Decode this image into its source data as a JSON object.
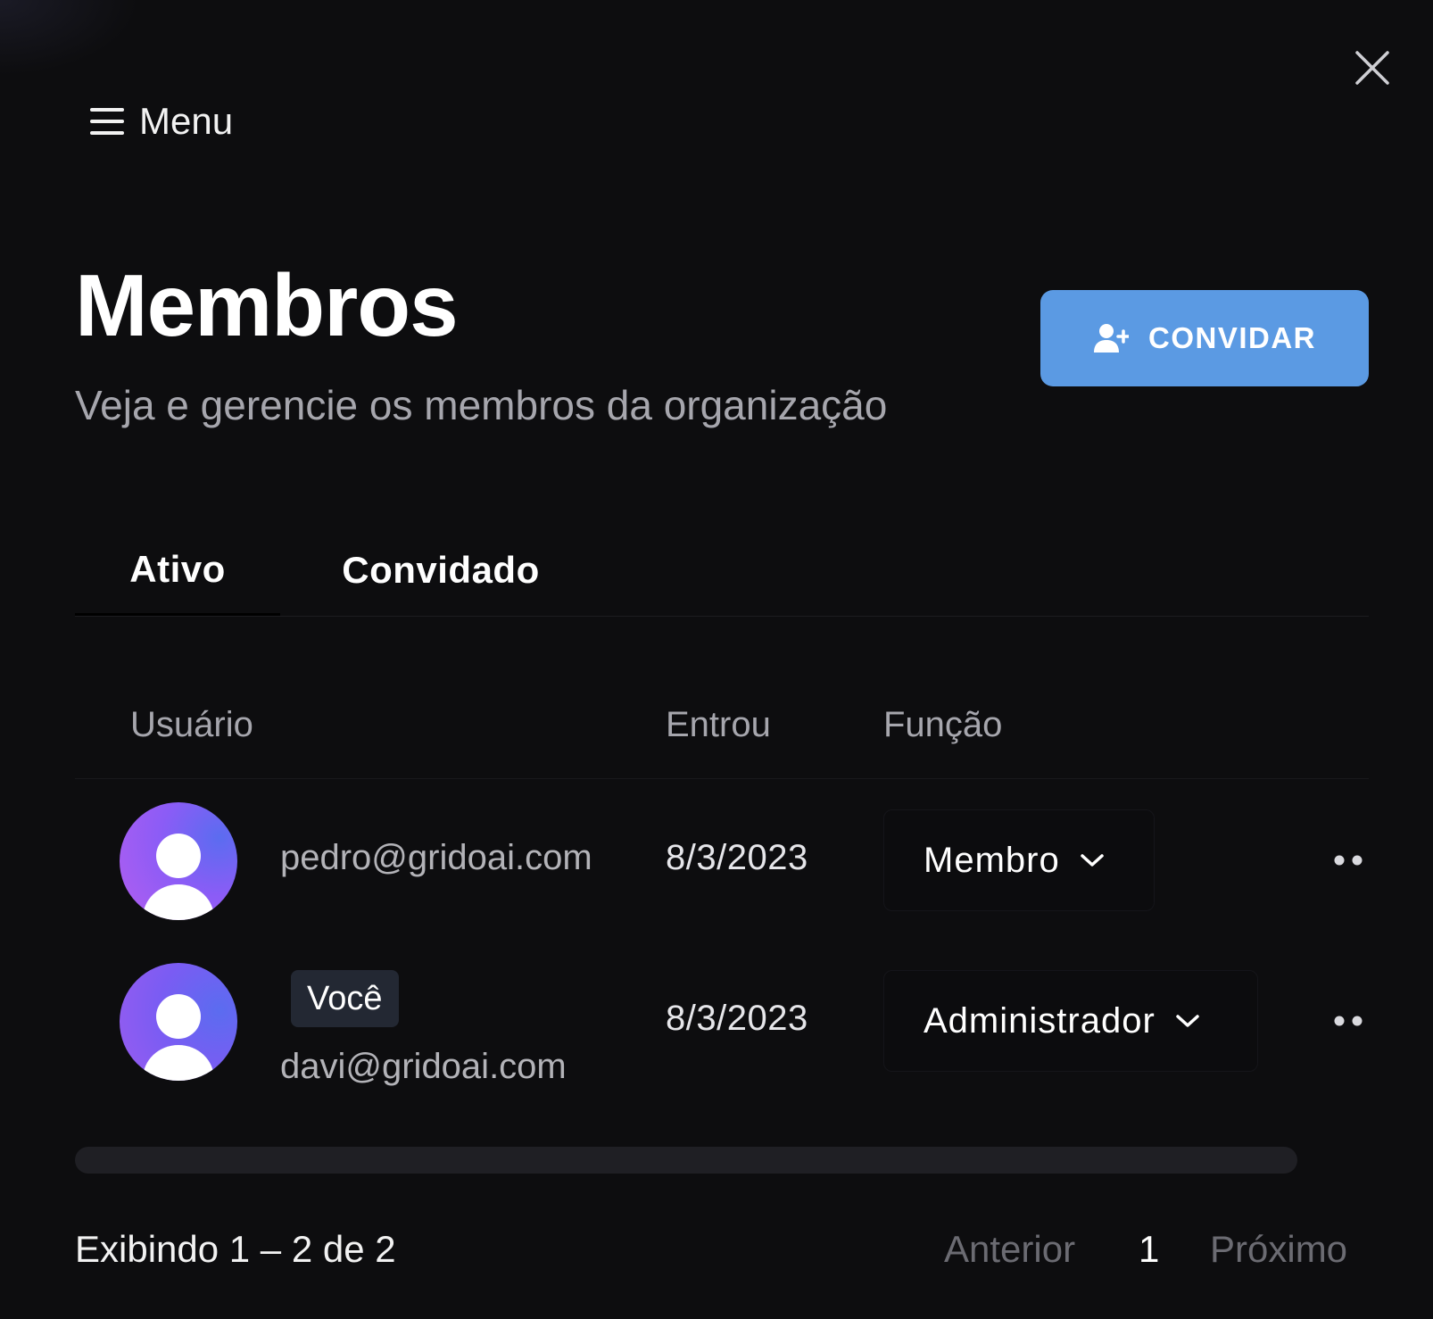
{
  "header": {
    "menu_label": "Menu",
    "title": "Membros",
    "subtitle": "Veja e gerencie os membros da organização",
    "invite_label": "CONVIDAR"
  },
  "tabs": [
    {
      "label": "Ativo",
      "active": true
    },
    {
      "label": "Convidado",
      "active": false
    }
  ],
  "table": {
    "columns": [
      "Usuário",
      "Entrou",
      "Função"
    ],
    "rows": [
      {
        "email": "pedro@gridoai.com",
        "joined": "8/3/2023",
        "role": "Membro",
        "badge": ""
      },
      {
        "email": "davi@gridoai.com",
        "joined": "8/3/2023",
        "role": "Administrador",
        "badge": "Você"
      }
    ]
  },
  "footer": {
    "showing": "Exibindo 1 – 2 de 2",
    "prev_label": "Anterior",
    "current_page": "1",
    "next_label": "Próximo"
  },
  "colors": {
    "background": "#0d0d0f",
    "accent": "#5b9ae3",
    "muted_text": "#a6a6ad",
    "badge_bg": "#232833"
  },
  "icons": {
    "close": "close-icon",
    "menu": "hamburger-icon",
    "invite": "user-plus-icon",
    "avatar": "user-avatar-icon",
    "dropdown": "chevron-down-icon",
    "more": "more-dots-icon"
  }
}
